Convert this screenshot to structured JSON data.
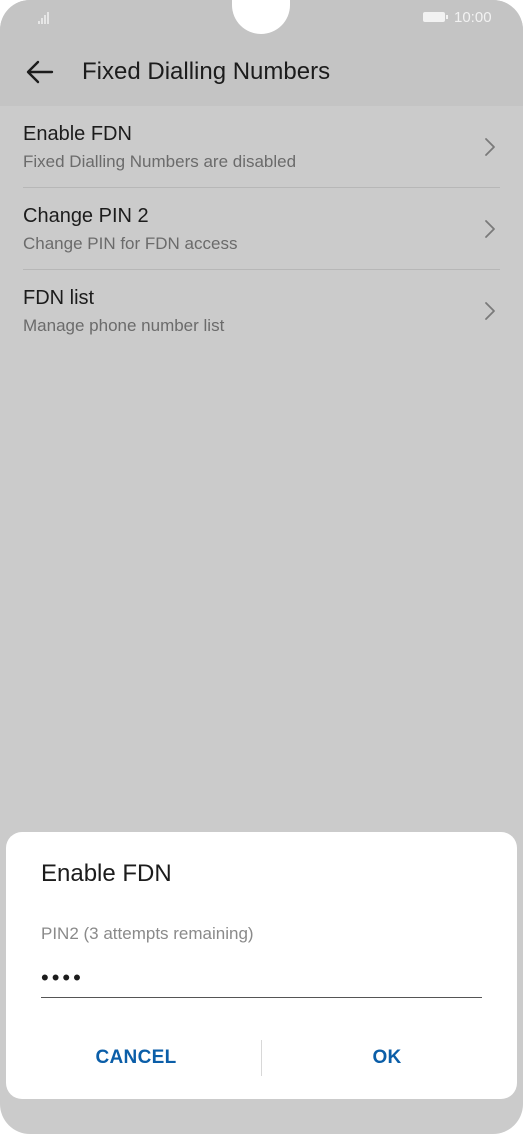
{
  "status_bar": {
    "time": "10:00",
    "signal_icon": "signal-icon",
    "battery_icon": "battery-icon"
  },
  "header": {
    "title": "Fixed Dialling Numbers",
    "back_icon": "arrow-left-icon"
  },
  "settings": {
    "items": [
      {
        "label": "Enable FDN",
        "summary": "Fixed Dialling Numbers are disabled",
        "icon": "chevron-right-icon"
      },
      {
        "label": "Change PIN 2",
        "summary": "Change PIN for FDN access",
        "icon": "chevron-right-icon"
      },
      {
        "label": "FDN list",
        "summary": "Manage phone number list",
        "icon": "chevron-right-icon"
      }
    ]
  },
  "dialog": {
    "title": "Enable FDN",
    "field_label": "PIN2 (3 attempts remaining)",
    "field_value": "••••",
    "cancel_label": "CANCEL",
    "ok_label": "OK"
  },
  "colors": {
    "background_dim": "#cbcbcb",
    "accent": "#0b5ea8",
    "primary_text": "#1c1c1c",
    "secondary_text": "#6b6b6b"
  }
}
